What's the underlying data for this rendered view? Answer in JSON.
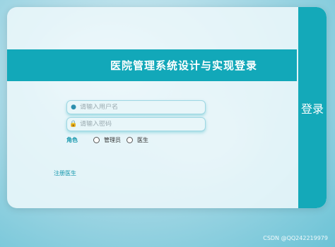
{
  "header": {
    "title": "医院管理系统设计与实现登录"
  },
  "side_button": {
    "label": "登录"
  },
  "form": {
    "username": {
      "placeholder": "请输入用户名",
      "value": ""
    },
    "password": {
      "placeholder": "请输入密码",
      "value": ""
    },
    "role": {
      "label": "角色",
      "options": [
        "管理员",
        "医生"
      ]
    },
    "register_link": "注册医生"
  },
  "watermark": "CSDN @QQ242219979",
  "colors": {
    "accent": "#12a8b9",
    "link": "#1597ad"
  },
  "icons": {
    "user": "user-icon",
    "lock": "lock-icon"
  }
}
